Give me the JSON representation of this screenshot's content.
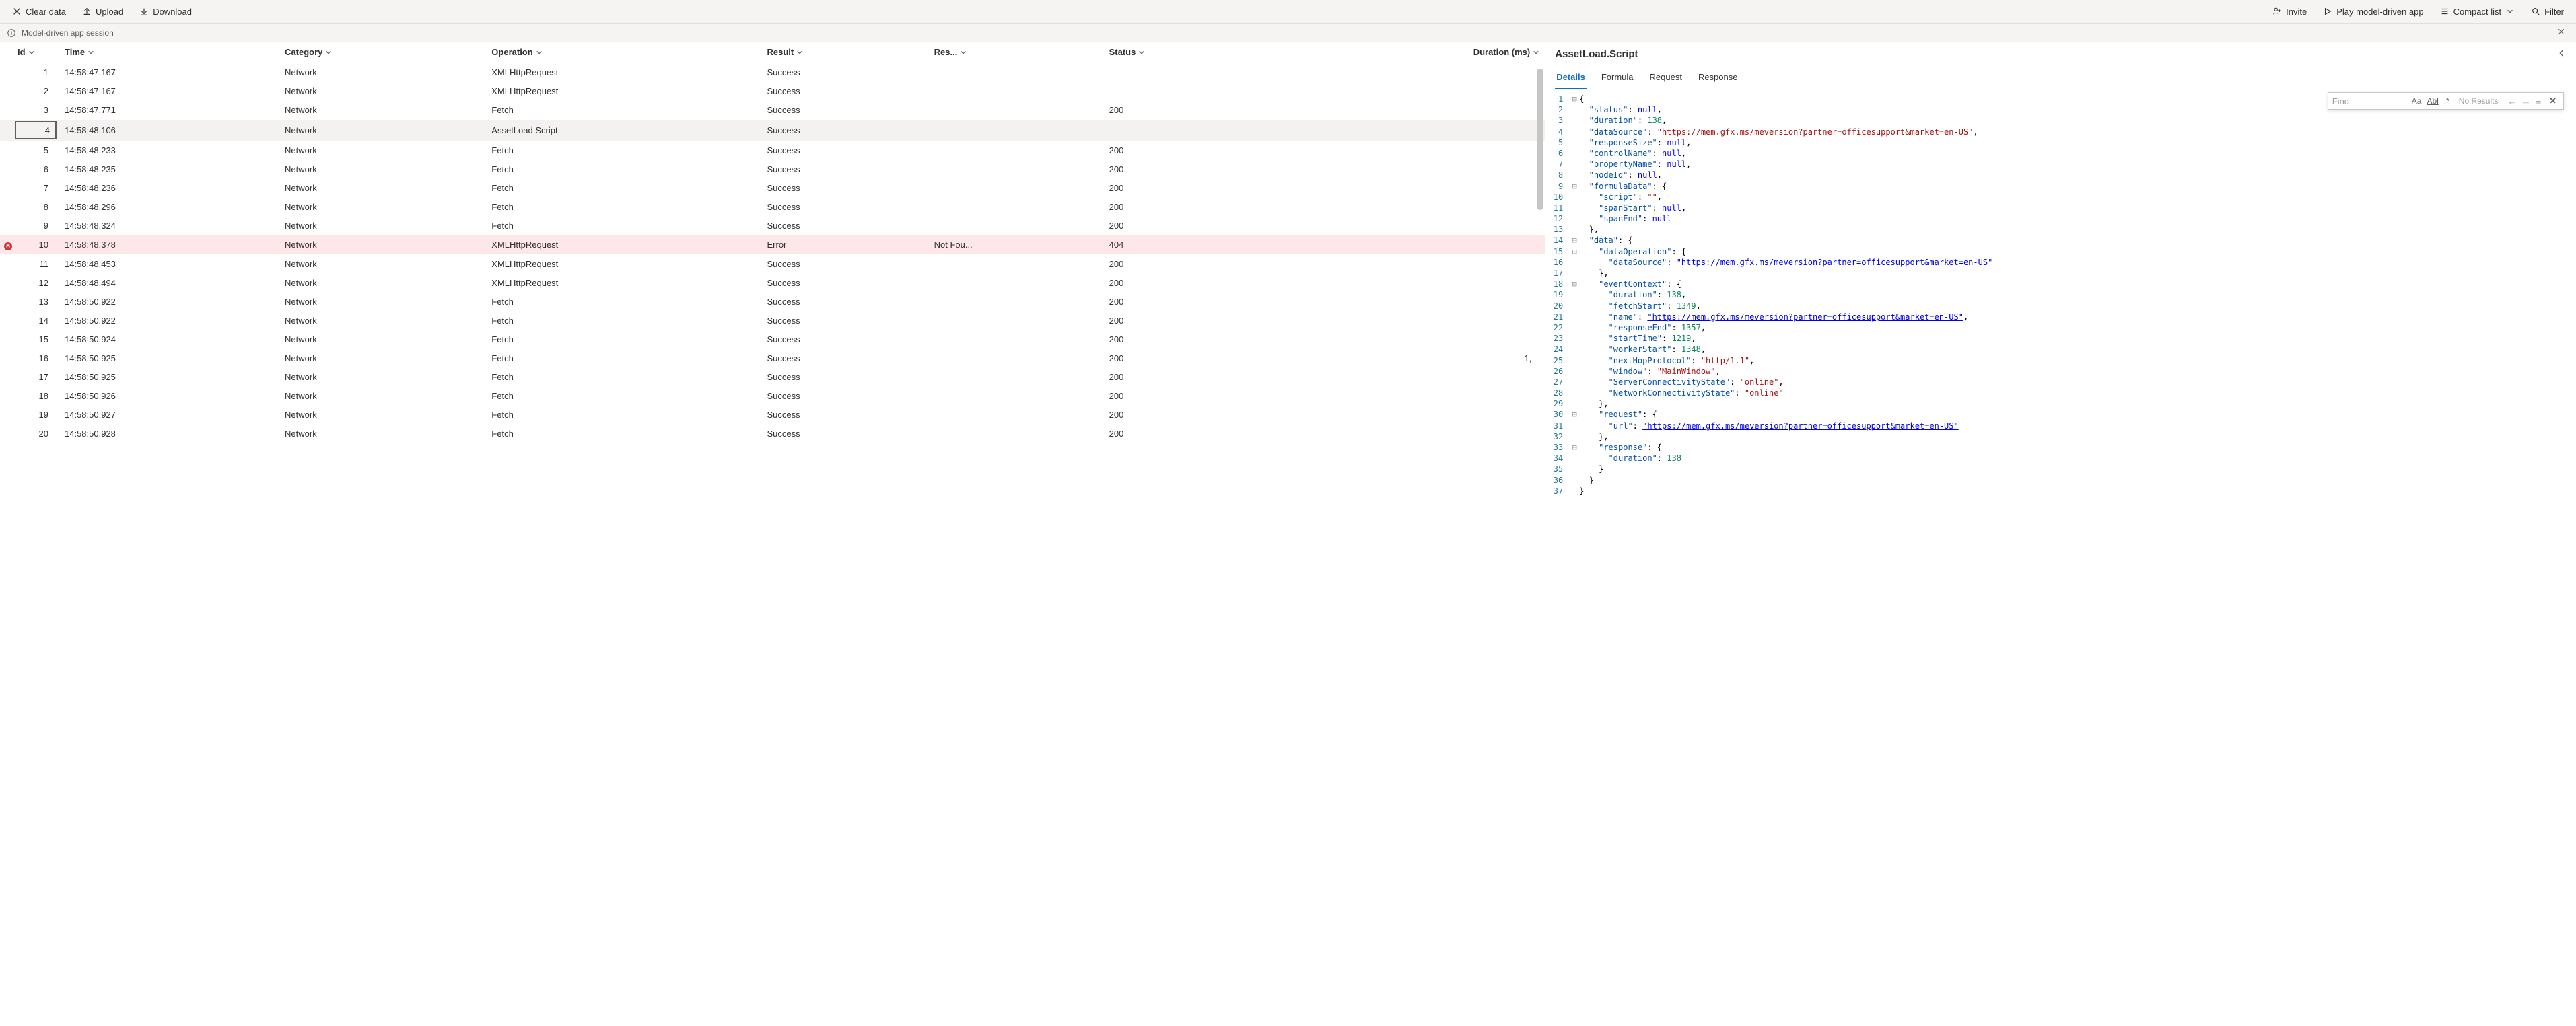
{
  "toolbar": {
    "left": {
      "clear_data": "Clear data",
      "upload": "Upload",
      "download": "Download"
    },
    "right": {
      "invite": "Invite",
      "play": "Play model-driven app",
      "compact_list": "Compact list",
      "filter": "Filter"
    }
  },
  "session": {
    "title": "Model-driven app session"
  },
  "table": {
    "columns": {
      "id": "Id",
      "time": "Time",
      "category": "Category",
      "operation": "Operation",
      "result": "Result",
      "res": "Res...",
      "status": "Status",
      "duration": "Duration (ms)"
    },
    "rows": [
      {
        "id": "1",
        "time": "14:58:47.167",
        "category": "Network",
        "operation": "XMLHttpRequest",
        "result": "Success",
        "res": "",
        "status": "",
        "duration": "",
        "kind": ""
      },
      {
        "id": "2",
        "time": "14:58:47.167",
        "category": "Network",
        "operation": "XMLHttpRequest",
        "result": "Success",
        "res": "",
        "status": "",
        "duration": "",
        "kind": ""
      },
      {
        "id": "3",
        "time": "14:58:47.771",
        "category": "Network",
        "operation": "Fetch",
        "result": "Success",
        "res": "",
        "status": "200",
        "duration": "",
        "kind": ""
      },
      {
        "id": "4",
        "time": "14:58:48.106",
        "category": "Network",
        "operation": "AssetLoad.Script",
        "result": "Success",
        "res": "",
        "status": "",
        "duration": "",
        "kind": "selected"
      },
      {
        "id": "5",
        "time": "14:58:48.233",
        "category": "Network",
        "operation": "Fetch",
        "result": "Success",
        "res": "",
        "status": "200",
        "duration": "",
        "kind": ""
      },
      {
        "id": "6",
        "time": "14:58:48.235",
        "category": "Network",
        "operation": "Fetch",
        "result": "Success",
        "res": "",
        "status": "200",
        "duration": "",
        "kind": ""
      },
      {
        "id": "7",
        "time": "14:58:48.236",
        "category": "Network",
        "operation": "Fetch",
        "result": "Success",
        "res": "",
        "status": "200",
        "duration": "",
        "kind": ""
      },
      {
        "id": "8",
        "time": "14:58:48.296",
        "category": "Network",
        "operation": "Fetch",
        "result": "Success",
        "res": "",
        "status": "200",
        "duration": "",
        "kind": ""
      },
      {
        "id": "9",
        "time": "14:58:48.324",
        "category": "Network",
        "operation": "Fetch",
        "result": "Success",
        "res": "",
        "status": "200",
        "duration": "",
        "kind": ""
      },
      {
        "id": "10",
        "time": "14:58:48.378",
        "category": "Network",
        "operation": "XMLHttpRequest",
        "result": "Error",
        "res": "Not Fou...",
        "status": "404",
        "duration": "",
        "kind": "error"
      },
      {
        "id": "11",
        "time": "14:58:48.453",
        "category": "Network",
        "operation": "XMLHttpRequest",
        "result": "Success",
        "res": "",
        "status": "200",
        "duration": "",
        "kind": ""
      },
      {
        "id": "12",
        "time": "14:58:48.494",
        "category": "Network",
        "operation": "XMLHttpRequest",
        "result": "Success",
        "res": "",
        "status": "200",
        "duration": "",
        "kind": ""
      },
      {
        "id": "13",
        "time": "14:58:50.922",
        "category": "Network",
        "operation": "Fetch",
        "result": "Success",
        "res": "",
        "status": "200",
        "duration": "",
        "kind": ""
      },
      {
        "id": "14",
        "time": "14:58:50.922",
        "category": "Network",
        "operation": "Fetch",
        "result": "Success",
        "res": "",
        "status": "200",
        "duration": "",
        "kind": ""
      },
      {
        "id": "15",
        "time": "14:58:50.924",
        "category": "Network",
        "operation": "Fetch",
        "result": "Success",
        "res": "",
        "status": "200",
        "duration": "",
        "kind": ""
      },
      {
        "id": "16",
        "time": "14:58:50.925",
        "category": "Network",
        "operation": "Fetch",
        "result": "Success",
        "res": "",
        "status": "200",
        "duration": "1,",
        "kind": ""
      },
      {
        "id": "17",
        "time": "14:58:50.925",
        "category": "Network",
        "operation": "Fetch",
        "result": "Success",
        "res": "",
        "status": "200",
        "duration": "",
        "kind": ""
      },
      {
        "id": "18",
        "time": "14:58:50.926",
        "category": "Network",
        "operation": "Fetch",
        "result": "Success",
        "res": "",
        "status": "200",
        "duration": "",
        "kind": ""
      },
      {
        "id": "19",
        "time": "14:58:50.927",
        "category": "Network",
        "operation": "Fetch",
        "result": "Success",
        "res": "",
        "status": "200",
        "duration": "",
        "kind": ""
      },
      {
        "id": "20",
        "time": "14:58:50.928",
        "category": "Network",
        "operation": "Fetch",
        "result": "Success",
        "res": "",
        "status": "200",
        "duration": "",
        "kind": ""
      }
    ]
  },
  "detail": {
    "title": "AssetLoad.Script",
    "tabs": {
      "details": "Details",
      "formula": "Formula",
      "request": "Request",
      "response": "Response"
    },
    "find": {
      "placeholder": "Find",
      "no_results": "No Results"
    },
    "json_tokens": [
      {
        "n": "1",
        "f": "-",
        "ind": 0,
        "t": [
          [
            "punc",
            "{"
          ]
        ]
      },
      {
        "n": "2",
        "f": "",
        "ind": 1,
        "t": [
          [
            "key",
            "\"status\""
          ],
          [
            "punc",
            ": "
          ],
          [
            "null",
            "null"
          ],
          [
            "punc",
            ","
          ]
        ]
      },
      {
        "n": "3",
        "f": "",
        "ind": 1,
        "t": [
          [
            "key",
            "\"duration\""
          ],
          [
            "punc",
            ": "
          ],
          [
            "num",
            "138"
          ],
          [
            "punc",
            ","
          ]
        ]
      },
      {
        "n": "4",
        "f": "",
        "ind": 1,
        "t": [
          [
            "key",
            "\"dataSource\""
          ],
          [
            "punc",
            ": "
          ],
          [
            "str",
            "\"https://mem.gfx.ms/meversion?partner=officesupport&market=en-US\""
          ],
          [
            "punc",
            ","
          ]
        ]
      },
      {
        "n": "5",
        "f": "",
        "ind": 1,
        "t": [
          [
            "key",
            "\"responseSize\""
          ],
          [
            "punc",
            ": "
          ],
          [
            "null",
            "null"
          ],
          [
            "punc",
            ","
          ]
        ]
      },
      {
        "n": "6",
        "f": "",
        "ind": 1,
        "t": [
          [
            "key",
            "\"controlName\""
          ],
          [
            "punc",
            ": "
          ],
          [
            "null",
            "null"
          ],
          [
            "punc",
            ","
          ]
        ]
      },
      {
        "n": "7",
        "f": "",
        "ind": 1,
        "t": [
          [
            "key",
            "\"propertyName\""
          ],
          [
            "punc",
            ": "
          ],
          [
            "null",
            "null"
          ],
          [
            "punc",
            ","
          ]
        ]
      },
      {
        "n": "8",
        "f": "",
        "ind": 1,
        "t": [
          [
            "key",
            "\"nodeId\""
          ],
          [
            "punc",
            ": "
          ],
          [
            "null",
            "null"
          ],
          [
            "punc",
            ","
          ]
        ]
      },
      {
        "n": "9",
        "f": "-",
        "ind": 1,
        "t": [
          [
            "key",
            "\"formulaData\""
          ],
          [
            "punc",
            ": {"
          ]
        ]
      },
      {
        "n": "10",
        "f": "",
        "ind": 2,
        "t": [
          [
            "key",
            "\"script\""
          ],
          [
            "punc",
            ": "
          ],
          [
            "str",
            "\"\""
          ],
          [
            "punc",
            ","
          ]
        ]
      },
      {
        "n": "11",
        "f": "",
        "ind": 2,
        "t": [
          [
            "key",
            "\"spanStart\""
          ],
          [
            "punc",
            ": "
          ],
          [
            "null",
            "null"
          ],
          [
            "punc",
            ","
          ]
        ]
      },
      {
        "n": "12",
        "f": "",
        "ind": 2,
        "t": [
          [
            "key",
            "\"spanEnd\""
          ],
          [
            "punc",
            ": "
          ],
          [
            "null",
            "null"
          ]
        ]
      },
      {
        "n": "13",
        "f": "",
        "ind": 1,
        "t": [
          [
            "punc",
            "},"
          ]
        ]
      },
      {
        "n": "14",
        "f": "-",
        "ind": 1,
        "t": [
          [
            "key",
            "\"data\""
          ],
          [
            "punc",
            ": {"
          ]
        ]
      },
      {
        "n": "15",
        "f": "-",
        "ind": 2,
        "t": [
          [
            "key",
            "\"dataOperation\""
          ],
          [
            "punc",
            ": {"
          ]
        ]
      },
      {
        "n": "16",
        "f": "",
        "ind": 3,
        "t": [
          [
            "key",
            "\"dataSource\""
          ],
          [
            "punc",
            ": "
          ],
          [
            "url",
            "\"https://mem.gfx.ms/meversion?partner=officesupport&market=en-US\""
          ]
        ]
      },
      {
        "n": "17",
        "f": "",
        "ind": 2,
        "t": [
          [
            "punc",
            "},"
          ]
        ]
      },
      {
        "n": "18",
        "f": "-",
        "ind": 2,
        "t": [
          [
            "key",
            "\"eventContext\""
          ],
          [
            "punc",
            ": {"
          ]
        ]
      },
      {
        "n": "19",
        "f": "",
        "ind": 3,
        "t": [
          [
            "key",
            "\"duration\""
          ],
          [
            "punc",
            ": "
          ],
          [
            "num",
            "138"
          ],
          [
            "punc",
            ","
          ]
        ]
      },
      {
        "n": "20",
        "f": "",
        "ind": 3,
        "t": [
          [
            "key",
            "\"fetchStart\""
          ],
          [
            "punc",
            ": "
          ],
          [
            "num",
            "1349"
          ],
          [
            "punc",
            ","
          ]
        ]
      },
      {
        "n": "21",
        "f": "",
        "ind": 3,
        "t": [
          [
            "key",
            "\"name\""
          ],
          [
            "punc",
            ": "
          ],
          [
            "url",
            "\"https://mem.gfx.ms/meversion?partner=officesupport&market=en-US\""
          ],
          [
            "punc",
            ","
          ]
        ]
      },
      {
        "n": "22",
        "f": "",
        "ind": 3,
        "t": [
          [
            "key",
            "\"responseEnd\""
          ],
          [
            "punc",
            ": "
          ],
          [
            "num",
            "1357"
          ],
          [
            "punc",
            ","
          ]
        ]
      },
      {
        "n": "23",
        "f": "",
        "ind": 3,
        "t": [
          [
            "key",
            "\"startTime\""
          ],
          [
            "punc",
            ": "
          ],
          [
            "num",
            "1219"
          ],
          [
            "punc",
            ","
          ]
        ]
      },
      {
        "n": "24",
        "f": "",
        "ind": 3,
        "t": [
          [
            "key",
            "\"workerStart\""
          ],
          [
            "punc",
            ": "
          ],
          [
            "num",
            "1348"
          ],
          [
            "punc",
            ","
          ]
        ]
      },
      {
        "n": "25",
        "f": "",
        "ind": 3,
        "t": [
          [
            "key",
            "\"nextHopProtocol\""
          ],
          [
            "punc",
            ": "
          ],
          [
            "str",
            "\"http/1.1\""
          ],
          [
            "punc",
            ","
          ]
        ]
      },
      {
        "n": "26",
        "f": "",
        "ind": 3,
        "t": [
          [
            "key",
            "\"window\""
          ],
          [
            "punc",
            ": "
          ],
          [
            "str",
            "\"MainWindow\""
          ],
          [
            "punc",
            ","
          ]
        ]
      },
      {
        "n": "27",
        "f": "",
        "ind": 3,
        "t": [
          [
            "key",
            "\"ServerConnectivityState\""
          ],
          [
            "punc",
            ": "
          ],
          [
            "str",
            "\"online\""
          ],
          [
            "punc",
            ","
          ]
        ]
      },
      {
        "n": "28",
        "f": "",
        "ind": 3,
        "t": [
          [
            "key",
            "\"NetworkConnectivityState\""
          ],
          [
            "punc",
            ": "
          ],
          [
            "str",
            "\"online\""
          ]
        ]
      },
      {
        "n": "29",
        "f": "",
        "ind": 2,
        "t": [
          [
            "punc",
            "},"
          ]
        ]
      },
      {
        "n": "30",
        "f": "-",
        "ind": 2,
        "t": [
          [
            "key",
            "\"request\""
          ],
          [
            "punc",
            ": {"
          ]
        ]
      },
      {
        "n": "31",
        "f": "",
        "ind": 3,
        "t": [
          [
            "key",
            "\"url\""
          ],
          [
            "punc",
            ": "
          ],
          [
            "url",
            "\"https://mem.gfx.ms/meversion?partner=officesupport&market=en-US\""
          ]
        ]
      },
      {
        "n": "32",
        "f": "",
        "ind": 2,
        "t": [
          [
            "punc",
            "},"
          ]
        ]
      },
      {
        "n": "33",
        "f": "-",
        "ind": 2,
        "t": [
          [
            "key",
            "\"response\""
          ],
          [
            "punc",
            ": {"
          ]
        ]
      },
      {
        "n": "34",
        "f": "",
        "ind": 3,
        "t": [
          [
            "key",
            "\"duration\""
          ],
          [
            "punc",
            ": "
          ],
          [
            "num",
            "138"
          ]
        ]
      },
      {
        "n": "35",
        "f": "",
        "ind": 2,
        "t": [
          [
            "punc",
            "}"
          ]
        ]
      },
      {
        "n": "36",
        "f": "",
        "ind": 1,
        "t": [
          [
            "punc",
            "}"
          ]
        ]
      },
      {
        "n": "37",
        "f": "",
        "ind": 0,
        "t": [
          [
            "punc",
            "}"
          ]
        ]
      }
    ]
  }
}
